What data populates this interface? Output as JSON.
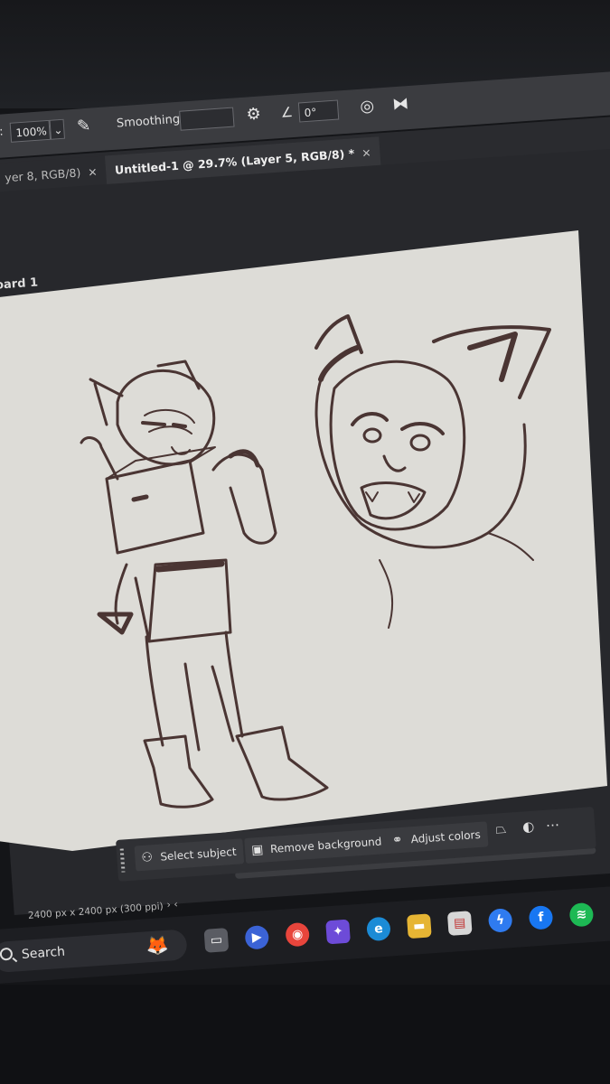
{
  "options_bar": {
    "flow_prefix": ":",
    "flow_value": "100%",
    "smoothing_label": "Smoothing:",
    "smoothing_value": "",
    "angle_value": "0°"
  },
  "tabs": [
    {
      "label": "yer 8, RGB/8)",
      "close": "×",
      "active": false
    },
    {
      "label": "Untitled-1 @ 29.7% (Layer 5, RGB/8) *",
      "close": "×",
      "active": true
    }
  ],
  "artboard_label": "oard 1",
  "contextual_bar": {
    "select_subject": "Select subject",
    "remove_background": "Remove background",
    "adjust_colors": "Adjust colors"
  },
  "status": {
    "doc_size": "2400 px x 2400 px (300 ppi)",
    "arrows": "›  ‹"
  },
  "taskbar": {
    "search_label": "Search",
    "apps": [
      "task-view",
      "meet",
      "chrome",
      "copilot",
      "edge",
      "file-explorer",
      "reader",
      "messenger",
      "facebook",
      "spotify"
    ]
  },
  "colors": {
    "sketch_ink": "#4a3533",
    "canvas_paper": "#dddcd7",
    "workspace": "#27282c"
  }
}
